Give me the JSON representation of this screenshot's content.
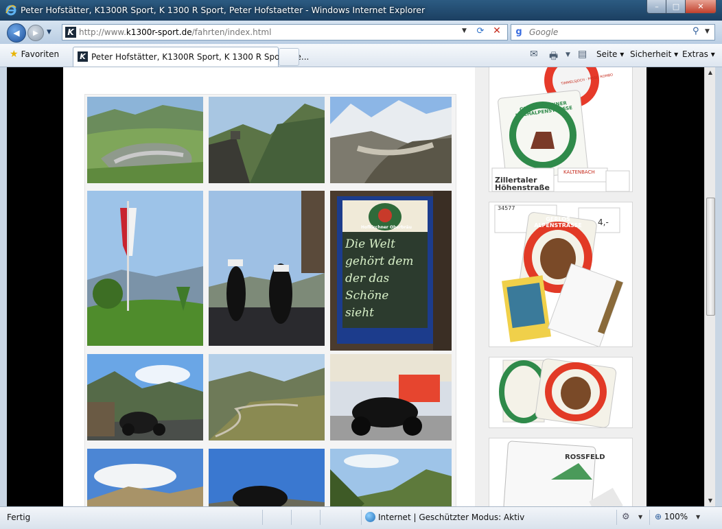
{
  "window": {
    "title": "Peter Hofstätter, K1300R Sport, K 1300 R Sport, Peter Hofstaetter - Windows Internet Explorer",
    "minimize_label": "–",
    "maximize_label": "□",
    "close_label": "✕"
  },
  "address_bar": {
    "url_prefix": "http://www.",
    "url_domain": "k1300r-sport.de",
    "url_path": "/fahrten/index.html"
  },
  "search": {
    "placeholder": "Google"
  },
  "command_bar": {
    "favorites_label": "Favoriten",
    "tab_title": "Peter Hofstätter, K1300R Sport, K 1300 R Sport, Pe...",
    "page_menu": "Seite ▾",
    "safety_menu": "Sicherheit ▾",
    "extras_menu": "Extras ▾"
  },
  "status_bar": {
    "status": "Fertig",
    "zone": "Internet | Geschützter Modus: Aktiv",
    "zoom": "100%"
  },
  "sidebar": {
    "ticket_zillertal": "Zillertaler Höhenstraße",
    "ticket_kaltenbach": "KALTENBACH",
    "ticket_grossglockner": "GROSSGLOCKNER HOCHALPENSTRASSE",
    "ticket_gerlos": "GERLOS ALPENSTRASSE",
    "ticket_timmelsjoch": "TIMMELSJOCH · PASSO ROMBO",
    "ticket_number": "34577",
    "ticket_price": "4,-",
    "ticket_rossfeld": "ROSSFELD"
  },
  "gallery": {
    "chalkboard_text": [
      "Die Welt",
      "gehört dem",
      "der das",
      "Schöne",
      "sieht"
    ],
    "chalkboard_brand": "Hofkirchner Oberbräu"
  },
  "colors": {
    "titlebar": "#2c5b82",
    "chalkboard": "#2c3b2e",
    "sign_frame": "#1c3c8c"
  }
}
